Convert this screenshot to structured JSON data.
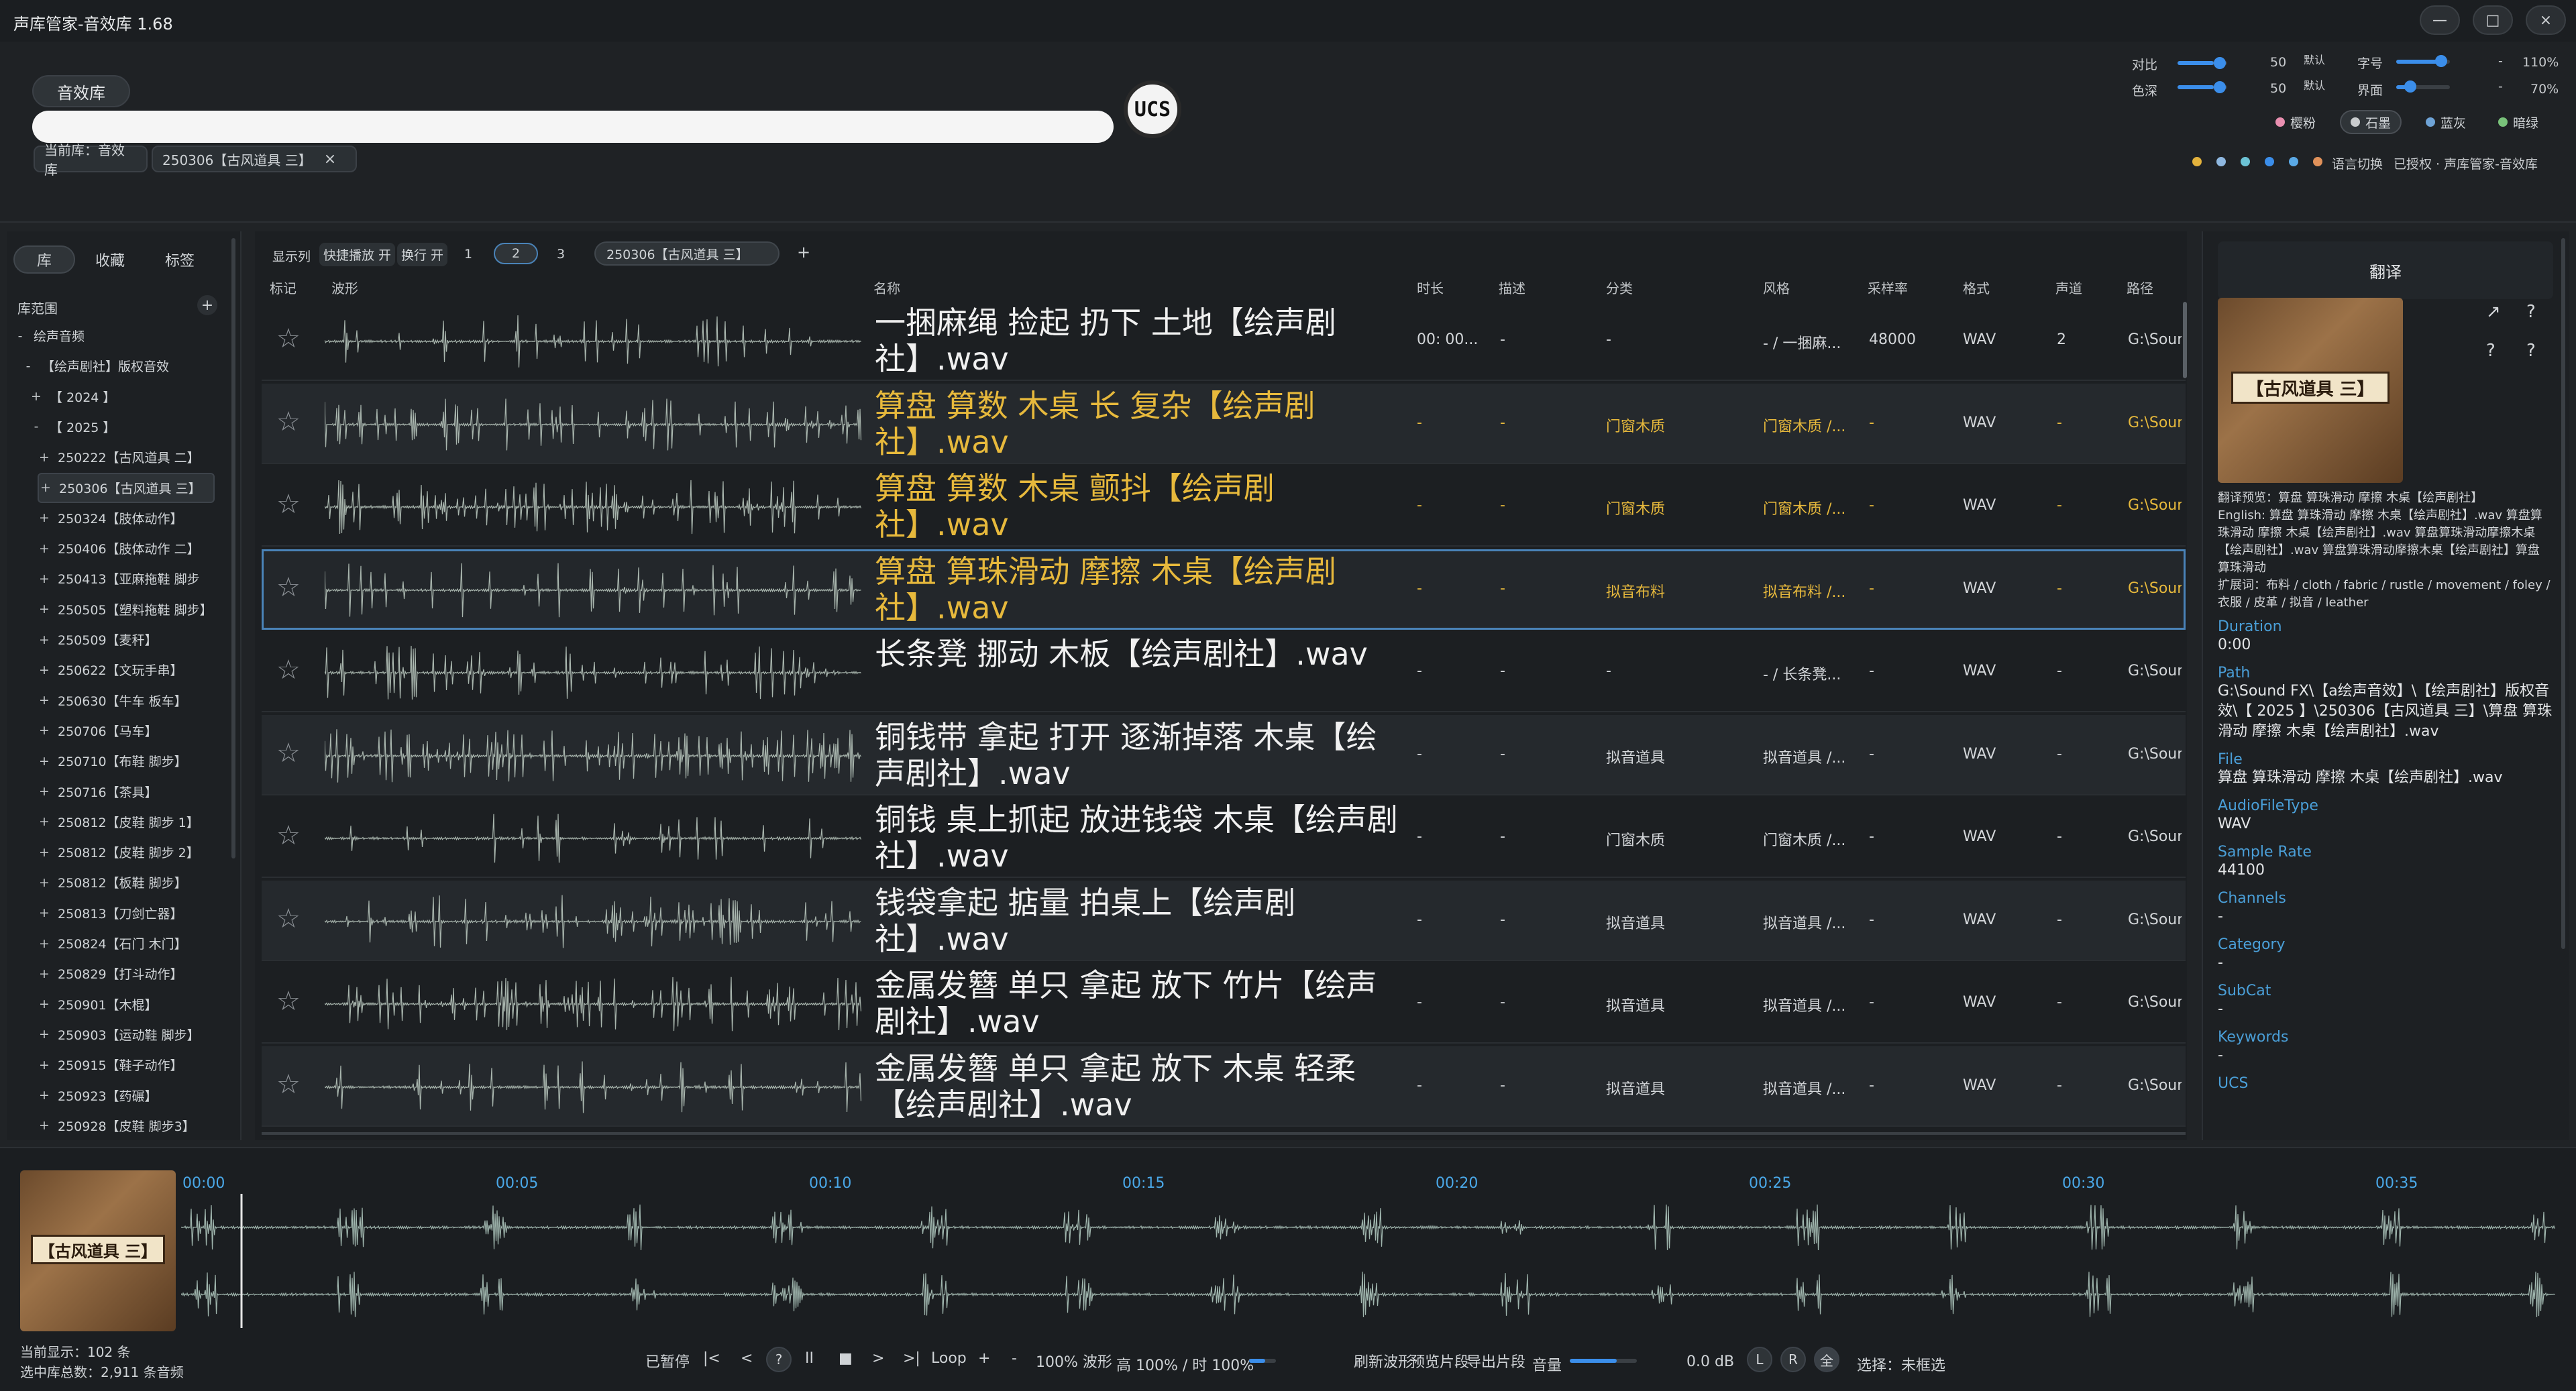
{
  "app": {
    "title": "声库管家-音效库  1.68",
    "window_controls": [
      "—",
      "□",
      "×"
    ]
  },
  "header": {
    "library_button": "音效库",
    "search_placeholder": "",
    "ucs_badge": "UCS",
    "crumb_current_library": "当前库：音效库",
    "crumb_folder": "250306【古风道具 三】",
    "crumb_close": "×"
  },
  "settings": {
    "contrast_label": "对比",
    "contrast_value": "50",
    "contrast_default": "默认",
    "saturation_label": "色深",
    "saturation_value": "50",
    "saturation_default": "默认",
    "font_label": "字号",
    "font_value": "110%",
    "ui_label": "界面",
    "ui_value": "70%",
    "minus": "-",
    "themes": [
      {
        "label": "樱粉",
        "color": "#e98fb0"
      },
      {
        "label": "石墨",
        "color": "#c9ccce"
      },
      {
        "label": "蓝灰",
        "color": "#6ea3d6"
      },
      {
        "label": "暗绿",
        "color": "#79c27a"
      }
    ],
    "accent_dots": [
      "#e3b23c",
      "#8fb8e0",
      "#6cc3d5",
      "#3b8eea",
      "#5aa9e6",
      "#e0915a"
    ],
    "language_switch": "语言切换",
    "license": "已授权 · 声库管家-音效库"
  },
  "left_panel": {
    "tabs": [
      "库",
      "收藏",
      "标签"
    ],
    "scope_title": "库范围",
    "add": "+",
    "tree": [
      {
        "label": "绘声音频",
        "exp": "-",
        "indent": 0
      },
      {
        "label": "【绘声剧社】版权音效",
        "exp": "-",
        "indent": 1
      },
      {
        "label": "【 2024 】",
        "exp": "+",
        "indent": 2
      },
      {
        "label": "【 2025 】",
        "exp": "-",
        "indent": 2
      },
      {
        "label": "250222【古风道具 二】",
        "exp": "+",
        "indent": 3
      },
      {
        "label": "250306【古风道具 三】",
        "exp": "+",
        "indent": 3,
        "selected": true
      },
      {
        "label": "250324【肢体动作】",
        "exp": "+",
        "indent": 3
      },
      {
        "label": "250406【肢体动作 二】",
        "exp": "+",
        "indent": 3
      },
      {
        "label": "250413【亚麻拖鞋 脚步",
        "exp": "+",
        "indent": 3
      },
      {
        "label": "250505【塑料拖鞋 脚步】",
        "exp": "+",
        "indent": 3
      },
      {
        "label": "250509【麦秆】",
        "exp": "+",
        "indent": 3
      },
      {
        "label": "250622【文玩手串】",
        "exp": "+",
        "indent": 3
      },
      {
        "label": "250630【牛车 板车】",
        "exp": "+",
        "indent": 3
      },
      {
        "label": "250706【马车】",
        "exp": "+",
        "indent": 3
      },
      {
        "label": "250710【布鞋 脚步】",
        "exp": "+",
        "indent": 3
      },
      {
        "label": "250716【茶具】",
        "exp": "+",
        "indent": 3
      },
      {
        "label": "250812【皮鞋 脚步 1】",
        "exp": "+",
        "indent": 3
      },
      {
        "label": "250812【皮鞋 脚步 2】",
        "exp": "+",
        "indent": 3
      },
      {
        "label": "250812【板鞋 脚步】",
        "exp": "+",
        "indent": 3
      },
      {
        "label": "250813【刀剑亡器】",
        "exp": "+",
        "indent": 3
      },
      {
        "label": "250824【石门 木门】",
        "exp": "+",
        "indent": 3
      },
      {
        "label": "250829【打斗动作】",
        "exp": "+",
        "indent": 3
      },
      {
        "label": "250901【木棍】",
        "exp": "+",
        "indent": 3
      },
      {
        "label": "250903【运动鞋 脚步】",
        "exp": "+",
        "indent": 3
      },
      {
        "label": "250915【鞋子动作】",
        "exp": "+",
        "indent": 3
      },
      {
        "label": "250923【药碾】",
        "exp": "+",
        "indent": 3
      },
      {
        "label": "250928【皮鞋 脚步3】",
        "exp": "+",
        "indent": 3
      }
    ]
  },
  "center": {
    "toolbar": {
      "show_columns": "显示列",
      "quick_play": "快捷播放 开",
      "wrap": "换行 开",
      "pages": [
        "1",
        "2",
        "3"
      ],
      "active_page": "2",
      "tab": "250306【古风道具 三】",
      "add_tab": "+"
    },
    "columns": {
      "mark": "标记",
      "wave": "波形",
      "name": "名称",
      "duration": "时长",
      "desc": "描述",
      "category": "分类",
      "style": "风格",
      "samplerate": "采样率",
      "format": "格式",
      "channels": "声道",
      "path": "路径"
    },
    "rows": [
      {
        "name": "一捆麻绳 捡起 扔下 土地【绘声剧社】.wav",
        "duration": "00: 00...",
        "desc": "-",
        "category": "-",
        "style": "- / 一捆麻...",
        "samplerate": "48000",
        "format": "WAV",
        "channels": "2",
        "path": "G:\\Sour",
        "hl": false
      },
      {
        "name": "算盘 算数 木桌 长 复杂【绘声剧社】.wav",
        "duration": "-",
        "desc": "-",
        "category": "门窗木质",
        "style": "门窗木质 /...",
        "samplerate": "-",
        "format": "WAV",
        "channels": "-",
        "path": "G:\\Sour",
        "hl": true
      },
      {
        "name": "算盘 算数 木桌 颤抖【绘声剧社】.wav",
        "duration": "-",
        "desc": "-",
        "category": "门窗木质",
        "style": "门窗木质 /...",
        "samplerate": "-",
        "format": "WAV",
        "channels": "-",
        "path": "G:\\Sour",
        "hl": true
      },
      {
        "name": "算盘 算珠滑动 摩擦 木桌【绘声剧社】.wav",
        "duration": "-",
        "desc": "-",
        "category": "拟音布料",
        "style": "拟音布料 /...",
        "samplerate": "-",
        "format": "WAV",
        "channels": "-",
        "path": "G:\\Sour",
        "hl": true,
        "selected": true
      },
      {
        "name": "长条凳 挪动 木板【绘声剧社】.wav",
        "duration": "-",
        "desc": "-",
        "category": "-",
        "style": "- / 长条凳...",
        "samplerate": "-",
        "format": "WAV",
        "channels": "-",
        "path": "G:\\Sour",
        "hl": false
      },
      {
        "name": "铜钱带 拿起 打开 逐渐掉落 木桌【绘声剧社】.wav",
        "duration": "-",
        "desc": "-",
        "category": "拟音道具",
        "style": "拟音道具 /...",
        "samplerate": "-",
        "format": "WAV",
        "channels": "-",
        "path": "G:\\Sour",
        "hl": false
      },
      {
        "name": "铜钱 桌上抓起 放进钱袋 木桌【绘声剧社】.wav",
        "duration": "-",
        "desc": "-",
        "category": "门窗木质",
        "style": "门窗木质 /...",
        "samplerate": "-",
        "format": "WAV",
        "channels": "-",
        "path": "G:\\Sour",
        "hl": false
      },
      {
        "name": "钱袋拿起 掂量  拍桌上【绘声剧社】.wav",
        "duration": "-",
        "desc": "-",
        "category": "拟音道具",
        "style": "拟音道具 /...",
        "samplerate": "-",
        "format": "WAV",
        "channels": "-",
        "path": "G:\\Sour",
        "hl": false
      },
      {
        "name": "金属发簪 单只 拿起 放下 竹片【绘声剧社】.wav",
        "duration": "-",
        "desc": "-",
        "category": "拟音道具",
        "style": "拟音道具 /...",
        "samplerate": "-",
        "format": "WAV",
        "channels": "-",
        "path": "G:\\Sour",
        "hl": false
      },
      {
        "name": "金属发簪 单只  拿起 放下 木桌 轻柔【绘声剧社】.wav",
        "duration": "-",
        "desc": "-",
        "category": "拟音道具",
        "style": "拟音道具 /...",
        "samplerate": "-",
        "format": "WAV",
        "channels": "-",
        "path": "G:\\Sour",
        "hl": false
      }
    ]
  },
  "right_panel": {
    "title": "翻译",
    "cover_label": "【古风道具 三】",
    "icon_buttons": [
      "↗",
      "?",
      "?",
      "?"
    ],
    "preview": "翻译预览：算盘 算珠滑动 摩擦 木桌【绘声剧社】",
    "english": "English: 算盘 算珠滑动 摩擦 木桌【绘声剧社】.wav 算盘算珠滑动 摩擦 木桌【绘声剧社】.wav 算盘算珠滑动摩擦木桌【绘声剧社】.wav 算盘算珠滑动摩擦木桌【绘声剧社】算盘 算珠滑动",
    "expand": "扩展词：布料 / cloth / fabric / rustle / movement / foley / 衣服 / 皮革 / 拟音 / leather",
    "fields": [
      {
        "label": "Duration",
        "value": "0:00"
      },
      {
        "label": "Path",
        "value": "G:\\Sound FX\\【a绘声音效】\\【绘声剧社】版权音效\\【 2025 】\\250306【古风道具 三】\\算盘 算珠滑动 摩擦 木桌【绘声剧社】.wav"
      },
      {
        "label": "File",
        "value": "算盘 算珠滑动 摩擦 木桌【绘声剧社】.wav"
      },
      {
        "label": "AudioFileType",
        "value": "WAV"
      },
      {
        "label": "Sample Rate",
        "value": "44100"
      },
      {
        "label": "Channels",
        "value": "-"
      },
      {
        "label": "Category",
        "value": "-"
      },
      {
        "label": "SubCat",
        "value": "-"
      },
      {
        "label": "Keywords",
        "value": "-"
      },
      {
        "label": "UCS",
        "value": ""
      }
    ]
  },
  "player": {
    "cover_label": "【古风道具 三】",
    "timeline": [
      "00:00",
      "00:05",
      "00:10",
      "00:15",
      "00:20",
      "00:25",
      "00:30",
      "00:35"
    ],
    "shown_count": "当前显示：102 条",
    "total_count": "选中库总数：2,911 条音频",
    "status": "已暂停",
    "controls": [
      "|<",
      "<",
      "?",
      "II",
      "■",
      ">",
      ">|"
    ],
    "loop": "Loop",
    "plus": "+",
    "minus": "-",
    "zoom": "100% 波形",
    "height": "高 100% / 时 100%",
    "refresh": "刷新波形",
    "preview_clip": "预览片段",
    "export_clip": "导出片段",
    "volume_label": "音量",
    "volume_db": "0.0 dB",
    "left": "L",
    "right": "R",
    "all": "全",
    "selection": "选择：未框选",
    "volume_level": 0.7,
    "zoom_level": 0.6
  }
}
